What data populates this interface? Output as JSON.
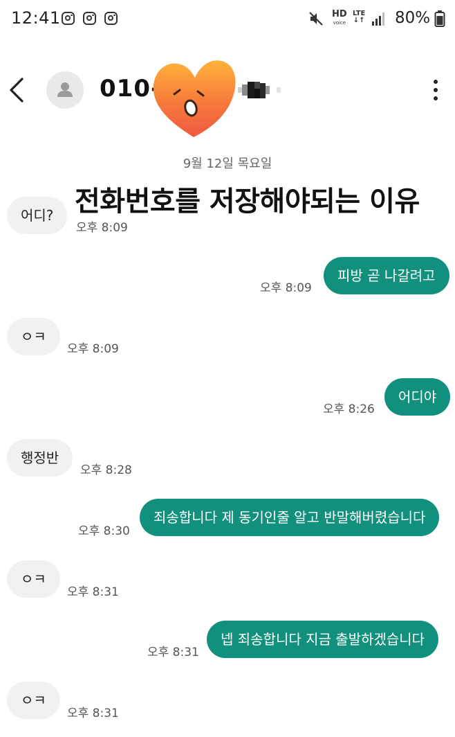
{
  "status_bar": {
    "time": "12:41",
    "battery": "80%",
    "hd_top": "HD",
    "hd_bottom": "voice",
    "lte": "LTE",
    "icons": [
      "instagram-icon",
      "instagram-icon",
      "instagram-icon",
      "mute-icon",
      "signal-icon",
      "battery-icon"
    ]
  },
  "header": {
    "contact_name": "010-",
    "back_icon": "chevron-left-icon",
    "avatar_icon": "person-icon",
    "more_icon": "more-vertical-icon",
    "censor_sticker": "heart-face-sticker"
  },
  "conversation": {
    "date": "9월 12일 목요일",
    "overlay_caption": "전화번호를 저장해야되는 이유",
    "messages": [
      {
        "dir": "in",
        "text": "어디?",
        "time": "오후 8:09"
      },
      {
        "dir": "out",
        "text": "피방 곧 나갈려고",
        "time": "오후 8:09"
      },
      {
        "dir": "in",
        "text": "ㅇㅋ",
        "time": "오후 8:09"
      },
      {
        "dir": "out",
        "text": "어디야",
        "time": "오후 8:26"
      },
      {
        "dir": "in",
        "text": "행정반",
        "time": "오후 8:28"
      },
      {
        "dir": "out",
        "text": "죄송합니다 제 동기인줄 알고 반말해버렸습니다",
        "time": "오후 8:30"
      },
      {
        "dir": "in",
        "text": "ㅇㅋ",
        "time": "오후 8:31"
      },
      {
        "dir": "out",
        "text": "넵 죄송합니다 지금 출발하겠습니다",
        "time": "오후 8:31"
      },
      {
        "dir": "in",
        "text": "ㅇㅋ",
        "time": "오후 8:31"
      }
    ]
  },
  "colors": {
    "outgoing_bubble": "#11907d",
    "incoming_bubble": "#f1f1f1",
    "sticker": "#f57a3a"
  }
}
